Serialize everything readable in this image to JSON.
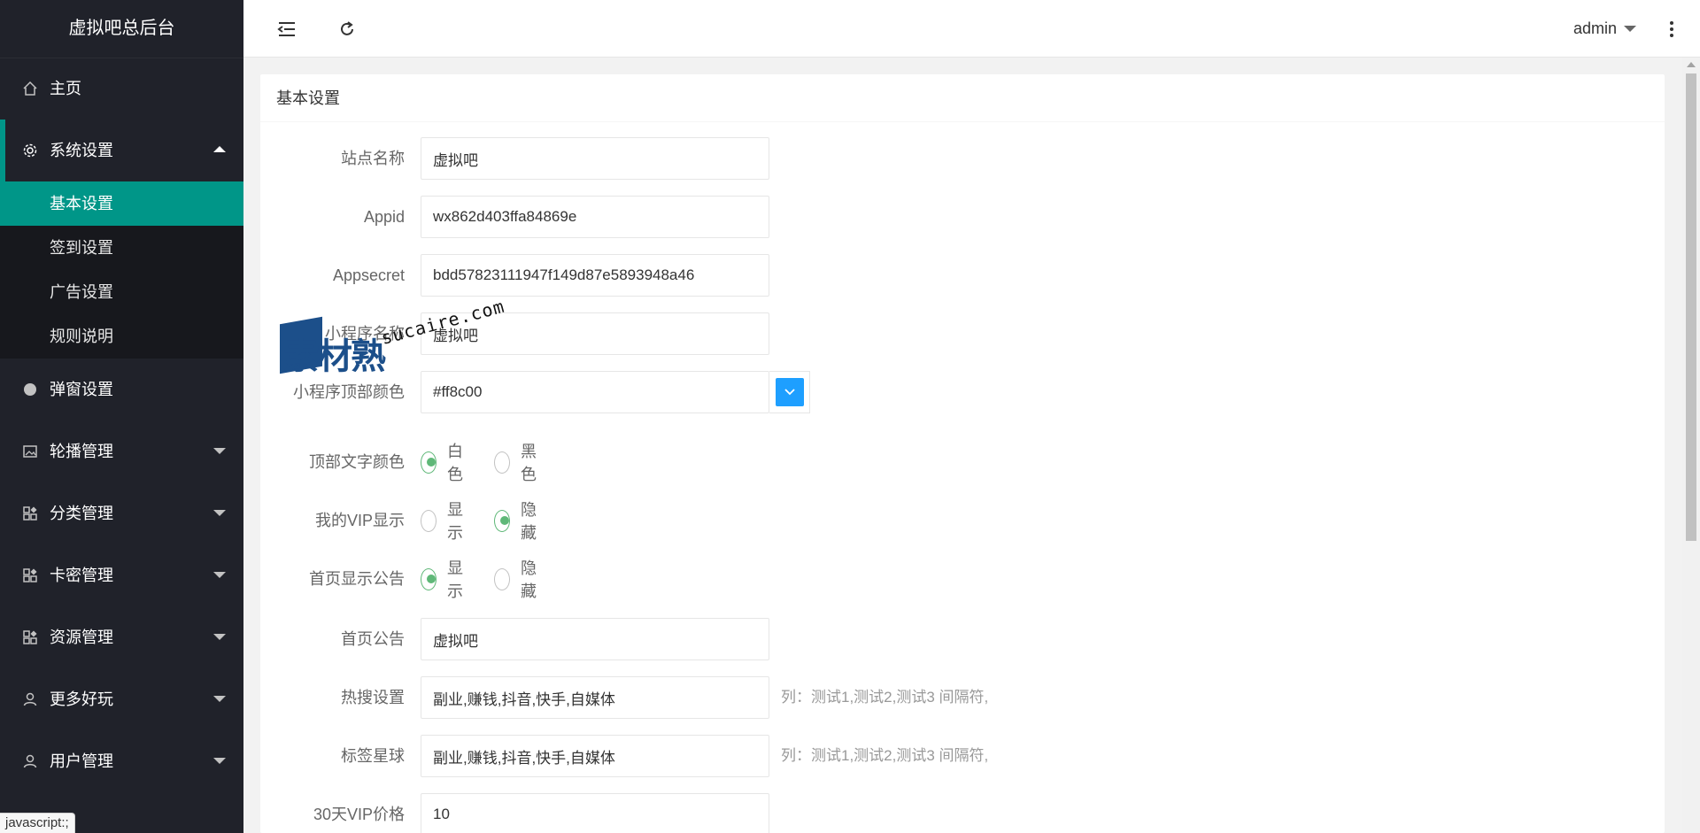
{
  "app": {
    "title": "虚拟吧总后台"
  },
  "sidebar": {
    "home": "主页",
    "system": {
      "label": "系统设置",
      "children": [
        "基本设置",
        "签到设置",
        "广告设置",
        "规则说明"
      ]
    },
    "items": [
      "弹窗设置",
      "轮播管理",
      "分类管理",
      "卡密管理",
      "资源管理",
      "更多好玩",
      "用户管理"
    ]
  },
  "header": {
    "user": "admin"
  },
  "card": {
    "title": "基本设置"
  },
  "form": {
    "site_name": {
      "label": "站点名称",
      "value": "虚拟吧"
    },
    "appid": {
      "label": "Appid",
      "value": "wx862d403ffa84869e"
    },
    "appsecret": {
      "label": "Appsecret",
      "value": "bdd57823111947f149d87e5893948a46"
    },
    "mini_name": {
      "label": "小程序名称",
      "value": "虚拟吧"
    },
    "top_color": {
      "label": "小程序顶部颜色",
      "value": "#ff8c00",
      "swatch": "#1e9fff"
    },
    "top_text_color": {
      "label": "顶部文字颜色",
      "options": [
        "白色",
        "黑色"
      ],
      "selected": "白色"
    },
    "vip_display": {
      "label": "我的VIP显示",
      "options": [
        "显示",
        "隐藏"
      ],
      "selected": "隐藏"
    },
    "home_notice_display": {
      "label": "首页显示公告",
      "options": [
        "显示",
        "隐藏"
      ],
      "selected": "显示"
    },
    "home_notice": {
      "label": "首页公告",
      "value": "虚拟吧"
    },
    "hot_search": {
      "label": "热搜设置",
      "value": "副业,赚钱,抖音,快手,自媒体",
      "hint": "列：测试1,测试2,测试3 间隔符,"
    },
    "tag_planet": {
      "label": "标签星球",
      "value": "副业,赚钱,抖音,快手,自媒体",
      "hint": "列：测试1,测试2,测试3 间隔符,"
    },
    "vip30_price": {
      "label": "30天VIP价格",
      "value": "10"
    }
  },
  "watermark": {
    "brand": "素材熟",
    "url": "sucaire.com"
  },
  "status_bar": {
    "text": "javascript:;"
  },
  "colors": {
    "sidebar_bg": "#20222a",
    "active": "#009688",
    "radio_checked": "#5fb878",
    "color_picker": "#1e9fff"
  }
}
